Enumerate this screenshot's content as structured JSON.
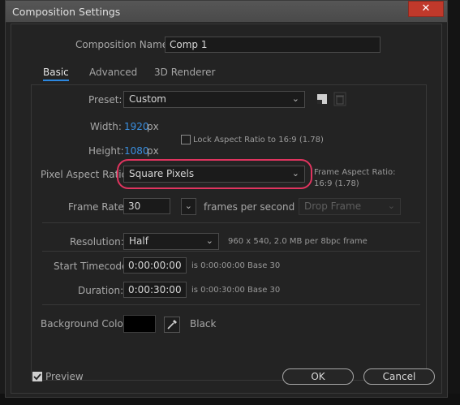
{
  "window": {
    "title": "Composition Settings",
    "close_glyph": "✕"
  },
  "comp_name": {
    "label": "Composition Name:",
    "value": "Comp 1"
  },
  "tabs": [
    {
      "label": "Basic",
      "active": true
    },
    {
      "label": "Advanced",
      "active": false
    },
    {
      "label": "3D Renderer",
      "active": false
    }
  ],
  "preset": {
    "label": "Preset:",
    "value": "Custom"
  },
  "width": {
    "label": "Width:",
    "value": "1920",
    "unit": "px"
  },
  "height": {
    "label": "Height:",
    "value": "1080",
    "unit": "px"
  },
  "lock_aspect": {
    "label": "Lock Aspect Ratio to 16:9 (1.78)",
    "checked": false
  },
  "pixel_aspect": {
    "label": "Pixel Aspect Ratio:",
    "value": "Square Pixels"
  },
  "frame_aspect": {
    "label": "Frame Aspect Ratio:",
    "value": "16:9 (1.78)"
  },
  "frame_rate": {
    "label": "Frame Rate:",
    "value": "30",
    "suffix": "frames per second",
    "drop_frame": "Drop Frame"
  },
  "resolution": {
    "label": "Resolution:",
    "value": "Half",
    "info": "960 x 540, 2.0 MB per 8bpc frame"
  },
  "start_timecode": {
    "label": "Start Timecode:",
    "value": "0:00:00:00",
    "info": "is 0:00:00:00  Base 30"
  },
  "duration": {
    "label": "Duration:",
    "value": "0:00:30:00",
    "info": "is 0:00:30:00  Base 30"
  },
  "background": {
    "label": "Background Color:",
    "color": "#000000",
    "name": "Black"
  },
  "preview": {
    "label": "Preview",
    "checked": true
  },
  "buttons": {
    "ok": "OK",
    "cancel": "Cancel"
  },
  "accent": {
    "link_blue": "#3a8fe0",
    "highlight": "#e0345f"
  }
}
